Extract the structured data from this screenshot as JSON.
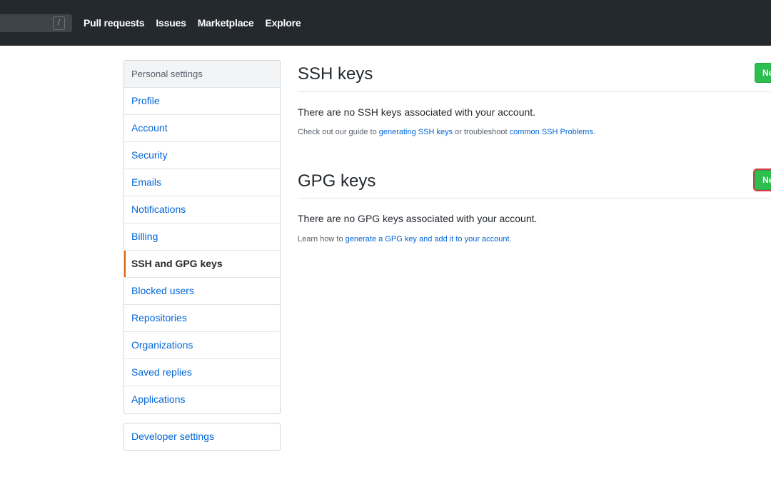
{
  "header": {
    "search_shortcut": "/",
    "nav": [
      "Pull requests",
      "Issues",
      "Marketplace",
      "Explore"
    ]
  },
  "sidebar": {
    "heading": "Personal settings",
    "items": [
      {
        "label": "Profile"
      },
      {
        "label": "Account"
      },
      {
        "label": "Security"
      },
      {
        "label": "Emails"
      },
      {
        "label": "Notifications"
      },
      {
        "label": "Billing"
      },
      {
        "label": "SSH and GPG keys",
        "selected": true
      },
      {
        "label": "Blocked users"
      },
      {
        "label": "Repositories"
      },
      {
        "label": "Organizations"
      },
      {
        "label": "Saved replies"
      },
      {
        "label": "Applications"
      }
    ],
    "developer_settings": "Developer settings"
  },
  "ssh": {
    "title": "SSH keys",
    "button": "New SSH key",
    "blank": "There are no SSH keys associated with your account.",
    "help_prefix": "Check out our guide to ",
    "help_link1": "generating SSH keys",
    "help_mid": " or troubleshoot ",
    "help_link2": "common SSH Problems",
    "help_suffix": "."
  },
  "gpg": {
    "title": "GPG keys",
    "button": "New GPG key",
    "blank": "There are no GPG keys associated with your account.",
    "help_prefix": "Learn how to ",
    "help_link": "generate a GPG key and add it to your account",
    "help_suffix": "."
  },
  "colors": {
    "header_bg": "#24292e",
    "link": "#0366d6",
    "selected_accent": "#e36209",
    "button_green": "#2cbe4e",
    "highlight_outline": "#d73a49"
  }
}
